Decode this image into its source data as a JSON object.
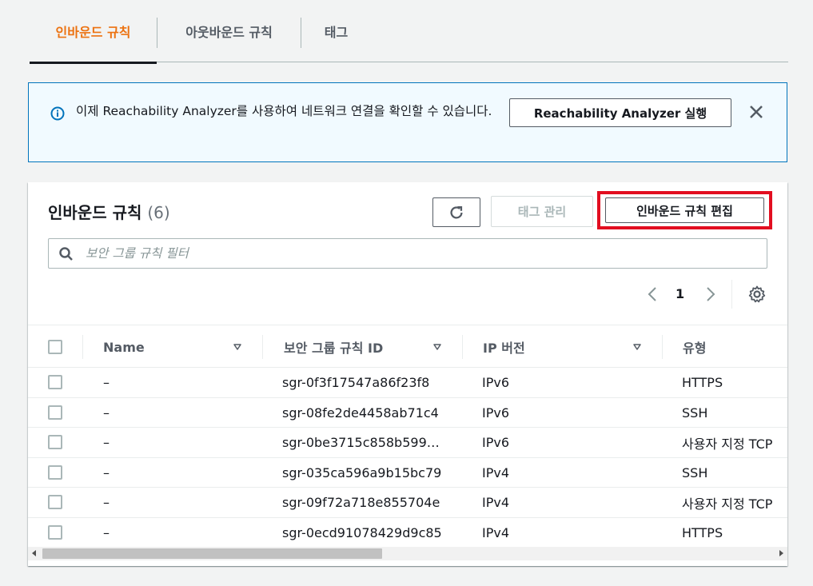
{
  "tabs": [
    {
      "label": "인바운드 규칙",
      "active": true
    },
    {
      "label": "아웃바운드 규칙",
      "active": false
    },
    {
      "label": "태그",
      "active": false
    }
  ],
  "flash": {
    "message": "이제 Reachability Analyzer를 사용하여 네트워크 연결을 확인할 수 있습니다.",
    "button_label": "Reachability Analyzer 실행",
    "icon": "info-icon",
    "accent_color": "#0073bb",
    "background_color": "#f1faff"
  },
  "panel": {
    "title": "인바운드 규칙",
    "count": "(6)",
    "tag_manage_label": "태그 관리",
    "edit_label": "인바운드 규칙 편집",
    "highlight_color": "#e20e20"
  },
  "search": {
    "placeholder": "보안 그룹 규칙 필터",
    "value": ""
  },
  "pagination": {
    "current_page": "1"
  },
  "table": {
    "columns": [
      "Name",
      "보안 그룹 규칙 ID",
      "IP 버전",
      "유형"
    ],
    "rows": [
      {
        "name": "–",
        "rule_id": "sgr-0f3f17547a86f23f8",
        "ip_version": "IPv6",
        "type": "HTTPS"
      },
      {
        "name": "–",
        "rule_id": "sgr-08fe2de4458ab71c4",
        "ip_version": "IPv6",
        "type": "SSH"
      },
      {
        "name": "–",
        "rule_id": "sgr-0be3715c858b599…",
        "ip_version": "IPv6",
        "type": "사용자 지정 TCP"
      },
      {
        "name": "–",
        "rule_id": "sgr-035ca596a9b15bc79",
        "ip_version": "IPv4",
        "type": "SSH"
      },
      {
        "name": "–",
        "rule_id": "sgr-09f72a718e855704e",
        "ip_version": "IPv4",
        "type": "사용자 지정 TCP"
      },
      {
        "name": "–",
        "rule_id": "sgr-0ecd91078429d9c85",
        "ip_version": "IPv4",
        "type": "HTTPS"
      }
    ]
  },
  "colors": {
    "active_tab": "#ec7211",
    "text": "#16191f",
    "muted": "#545b64",
    "disabled": "#aab7b8"
  }
}
